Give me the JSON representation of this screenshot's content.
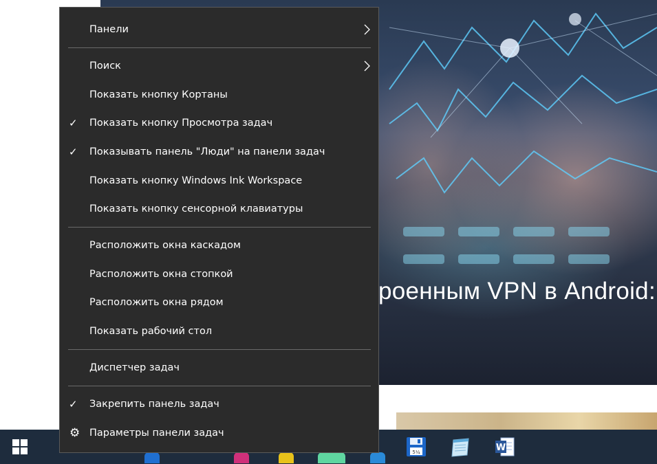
{
  "background_page": {
    "headline": "роенным VPN в Android: п"
  },
  "context_menu": {
    "items": [
      {
        "label": "Панели",
        "checked": false,
        "submenu": true
      },
      {
        "label": "Поиск",
        "checked": false,
        "submenu": true
      },
      {
        "label": "Показать кнопку Кортаны",
        "checked": false,
        "submenu": false
      },
      {
        "label": "Показать кнопку Просмотра задач",
        "checked": true,
        "submenu": false
      },
      {
        "label": "Показывать панель \"Люди\" на панели задач",
        "checked": true,
        "submenu": false
      },
      {
        "label": "Показать кнопку Windows Ink Workspace",
        "checked": false,
        "submenu": false
      },
      {
        "label": "Показать кнопку сенсорной клавиатуры",
        "checked": false,
        "submenu": false
      },
      {
        "label": "Расположить окна каскадом",
        "checked": false,
        "submenu": false
      },
      {
        "label": "Расположить окна стопкой",
        "checked": false,
        "submenu": false
      },
      {
        "label": "Расположить окна рядом",
        "checked": false,
        "submenu": false
      },
      {
        "label": "Показать рабочий стол",
        "checked": false,
        "submenu": false
      },
      {
        "label": "Диспетчер задач",
        "checked": false,
        "submenu": false
      },
      {
        "label": "Закрепить панель задач",
        "checked": true,
        "submenu": false
      },
      {
        "label": "Параметры панели задач",
        "checked": false,
        "submenu": false,
        "icon": "gear-icon"
      }
    ],
    "check_glyph": "✓",
    "gear_glyph": "⚙"
  },
  "taskbar": {
    "apps": [
      {
        "name": "floppy-save-icon",
        "caption": "5¼"
      },
      {
        "name": "notepad-icon"
      },
      {
        "name": "word-icon",
        "letter": "W"
      }
    ]
  },
  "colors": {
    "menu_bg": "#2b2b2b",
    "menu_text": "#ffffff",
    "separator": "#6a6a6a",
    "taskbar_bg": "#1e2c3d",
    "start_logo": "#ffffff"
  }
}
